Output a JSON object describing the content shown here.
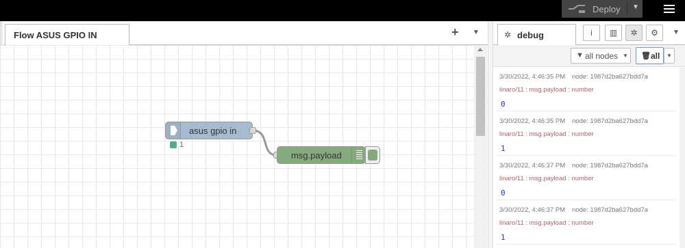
{
  "header": {
    "deploy_label": "Deploy"
  },
  "workspace": {
    "flow_tab_label": "Flow ASUS GPIO IN",
    "add_icon": "+",
    "more_icon": "▼"
  },
  "nodes": {
    "input_label": "asus gpio in",
    "input_status": "1",
    "debug_label": "msg.payload"
  },
  "sidebar": {
    "debug_tab_label": "debug",
    "filter_label": "all nodes",
    "clear_label": "all",
    "messages": [
      {
        "timestamp": "3/30/2022, 4:46:35 PM",
        "node": "node: 1987d2ba627bdd7a",
        "topic": "linaro/11 : msg.payload : number",
        "value": "0"
      },
      {
        "timestamp": "3/30/2022, 4:46:35 PM",
        "node": "node: 1987d2ba627bdd7a",
        "topic": "linaro/11 : msg.payload : number",
        "value": "1"
      },
      {
        "timestamp": "3/30/2022, 4:46:37 PM",
        "node": "node: 1987d2ba627bdd7a",
        "topic": "linaro/11 : msg.payload : number",
        "value": "0"
      },
      {
        "timestamp": "3/30/2022, 4:46:37 PM",
        "node": "node: 1987d2ba627bdd7a",
        "topic": "linaro/11 : msg.payload : number",
        "value": "1"
      }
    ]
  },
  "colors": {
    "header_bg": "#000000",
    "input_node": "#a6bbcf",
    "debug_node": "#87a980",
    "debug_value": "#2033d6"
  }
}
